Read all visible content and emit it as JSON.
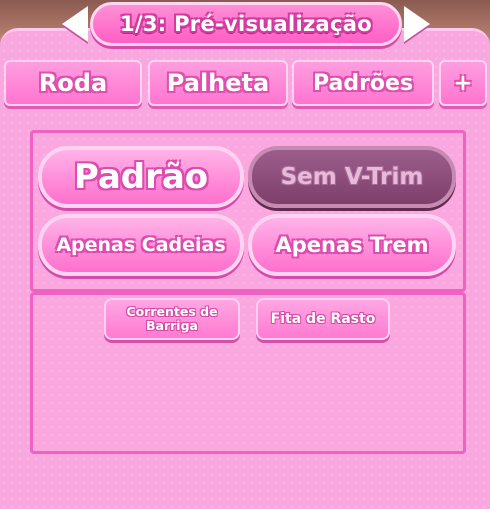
{
  "header": {
    "title": "1/3: Pré-visualização",
    "prev_icon": "arrow-left-icon",
    "next_icon": "arrow-right-icon"
  },
  "tabs": [
    {
      "label": "Roda"
    },
    {
      "label": "Palheta"
    },
    {
      "label": "Padrões"
    },
    {
      "label": "+"
    }
  ],
  "options": {
    "padrao": "Padrão",
    "sem_v_trim": "Sem V-Trim",
    "apenas_cadeias": "Apenas Cadeias",
    "apenas_trem": "Apenas Trem",
    "selected": "Sem V-Trim"
  },
  "extras": {
    "correntes_line1": "Correntes de",
    "correntes_line2": "Barriga",
    "fita_de_rasto": "Fita de Rasto"
  },
  "colors": {
    "panel": "#f9a8df",
    "accent": "#ff5fc4",
    "selected": "#7e3f6d",
    "border": "#ef62c2"
  }
}
